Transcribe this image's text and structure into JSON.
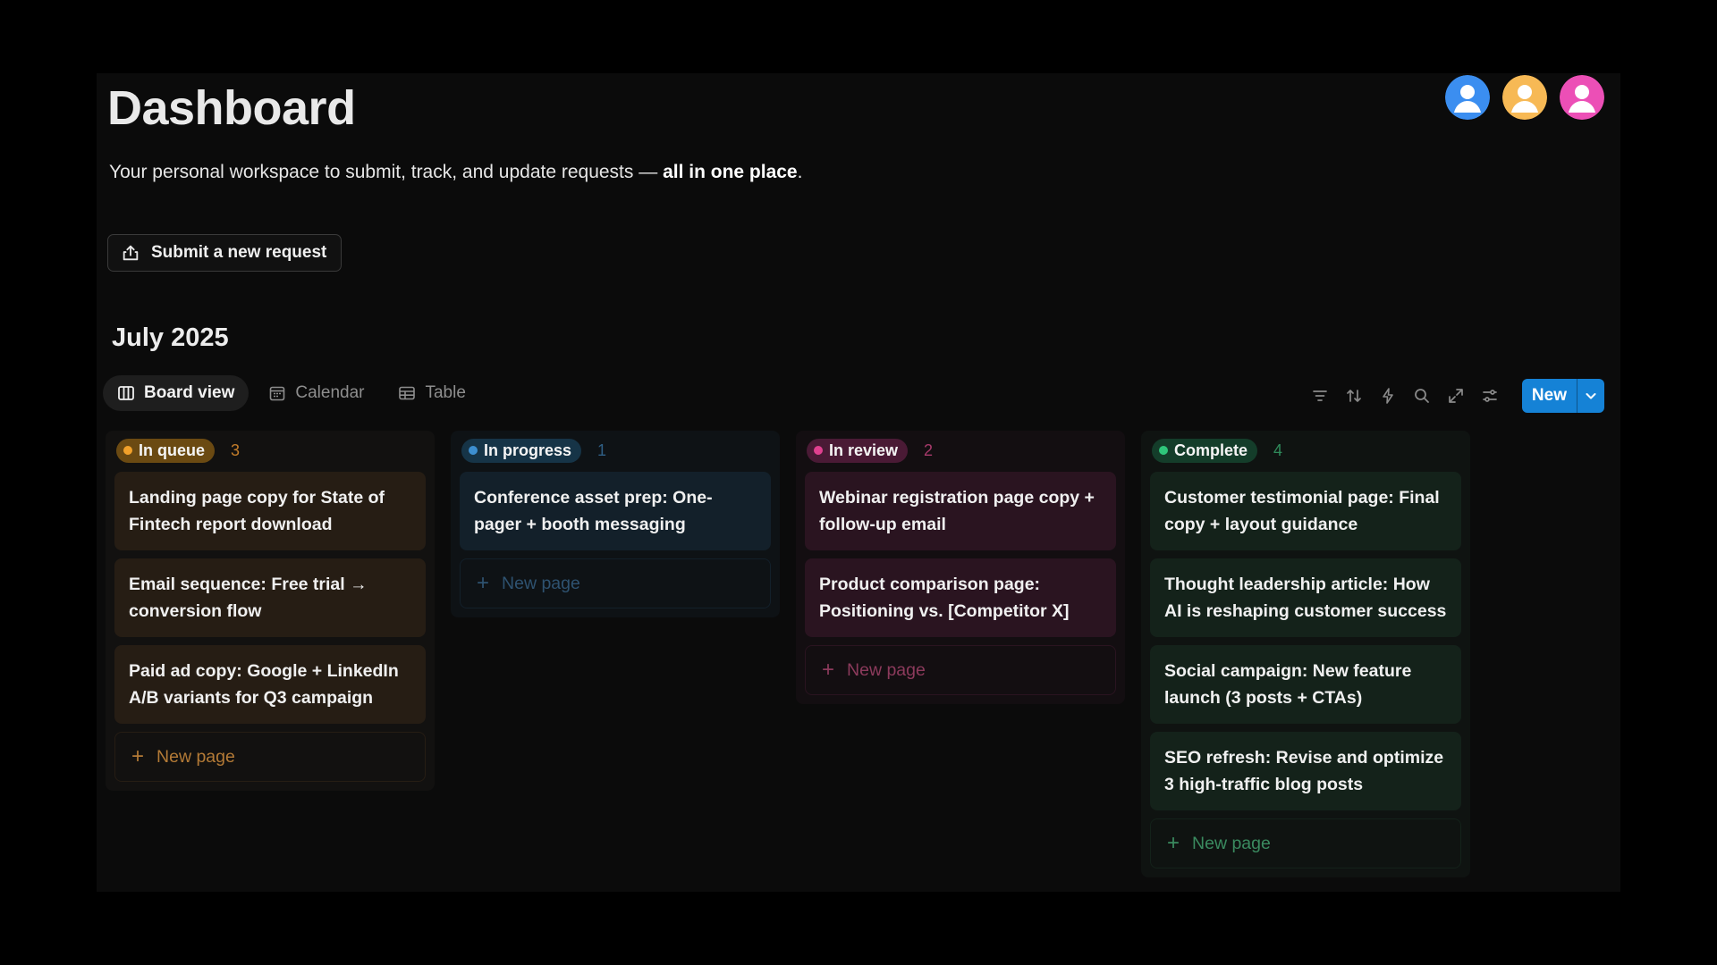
{
  "page": {
    "title": "Dashboard",
    "subtitle_prefix": "Your personal workspace to submit, track, and update requests — ",
    "subtitle_bold": "all in one place",
    "subtitle_suffix": "."
  },
  "avatars": [
    {
      "color": "#3b8ef0"
    },
    {
      "color": "#f7b955"
    },
    {
      "color": "#ec4fb6"
    }
  ],
  "submit_button": {
    "label": "Submit a new request",
    "icon": "upload-icon"
  },
  "month_heading": "July 2025",
  "tabs": [
    {
      "label": "Board view",
      "icon": "board-icon",
      "active": true
    },
    {
      "label": "Calendar",
      "icon": "calendar-icon",
      "active": false
    },
    {
      "label": "Table",
      "icon": "table-icon",
      "active": false
    }
  ],
  "toolbar": {
    "icons": [
      "filter-icon",
      "sort-icon",
      "automation-icon",
      "search-icon",
      "expand-icon",
      "settings-icon"
    ],
    "new_label": "New",
    "accent": "#1582d6"
  },
  "columns": [
    {
      "status": "In queue",
      "count": "3",
      "pill_bg": "#6b4a12",
      "dot": "#f2a12a",
      "count_color": "#c47d2a",
      "col_bg": "#121110",
      "card_bg": "#261d14",
      "new_color": "#b37a36",
      "cards": [
        "Landing page copy for State of Fintech report download",
        "Email sequence: Free trial → conversion flow",
        "Paid ad copy: Google + LinkedIn A/B variants for Q3 campaign"
      ],
      "new_label": "New page"
    },
    {
      "status": "In progress",
      "count": "1",
      "pill_bg": "#163447",
      "dot": "#3d8fd0",
      "count_color": "#2f5f85",
      "col_bg": "#0e1215",
      "card_bg": "#13202a",
      "new_color": "#2e5270",
      "cards": [
        "Conference asset prep: One-pager + booth messaging"
      ],
      "new_label": "New page"
    },
    {
      "status": "In review",
      "count": "2",
      "pill_bg": "#4a1a35",
      "dot": "#e0408f",
      "count_color": "#a83a6b",
      "col_bg": "#130e11",
      "card_bg": "#2a1420",
      "new_color": "#8c3a5c",
      "cards": [
        "Webinar registration page copy + follow-up email",
        "Product comparison page: Positioning vs. [Competitor X]"
      ],
      "new_label": "New page"
    },
    {
      "status": "Complete",
      "count": "4",
      "pill_bg": "#143d2a",
      "dot": "#2fc57a",
      "count_color": "#2f8a5a",
      "col_bg": "#0f1311",
      "card_bg": "#14221a",
      "new_color": "#3a8a5f",
      "cards": [
        "Customer testimonial page: Final copy + layout guidance",
        "Thought leadership article: How AI is reshaping customer success",
        "Social campaign: New feature launch (3 posts + CTAs)",
        "SEO refresh: Revise and optimize 3 high-traffic blog posts"
      ],
      "new_label": "New page"
    }
  ]
}
